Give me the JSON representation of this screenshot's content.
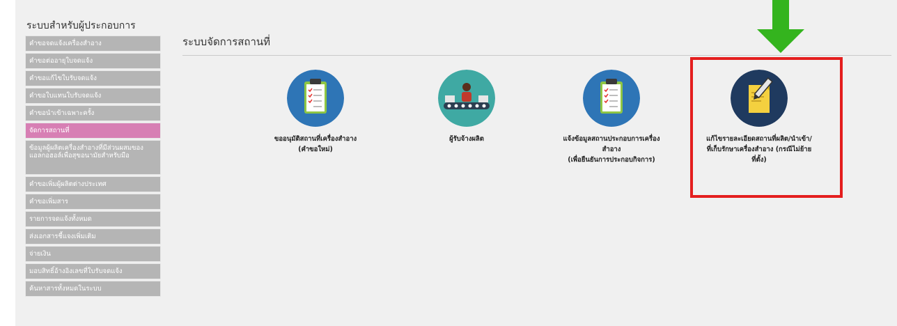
{
  "sidebar": {
    "title": "ระบบสำหรับผู้ประกอบการ",
    "items": [
      {
        "label": "คำขอจดแจ้งเครื่องสำอาง"
      },
      {
        "label": "คำขอต่ออายุใบจดแจ้ง"
      },
      {
        "label": "คำขอแก้ไขใบรับจดแจ้ง"
      },
      {
        "label": "คำขอใบแทนใบรับจดแจ้ง"
      },
      {
        "label": "คำขอนำเข้าเฉพาะครั้ง"
      },
      {
        "label": "จัดการสถานที่"
      },
      {
        "label": "ข้อมูลผู้ผลิตเครื่องสำอางที่มีส่วนผสมของแอลกอฮอล์เพื่อสุขอนามัยสำหรับมือ"
      },
      {
        "label": "คำขอเพิ่มผู้ผลิตต่างประเทศ"
      },
      {
        "label": "คำขอเพิ่มสาร"
      },
      {
        "label": "รายการจดแจ้งทั้งหมด"
      },
      {
        "label": "ส่งเอกสารชี้แจงเพิ่มเติม"
      },
      {
        "label": "จ่ายเงิน"
      },
      {
        "label": "มอบสิทธิ์อ้างอิงเลขที่ใบรับจดแจ้ง"
      },
      {
        "label": "ค้นหาสารทั้งหมดในระบบ"
      }
    ]
  },
  "main": {
    "title": "ระบบจัดการสถานที่",
    "tiles": [
      {
        "label": "ขออนุมัติสถานที่เครื่องสำอาง\n(คำขอใหม่)",
        "icon": "clipboard-icon"
      },
      {
        "label": "ผู้รับจ้างผลิต",
        "icon": "conveyor-worker-icon"
      },
      {
        "label": "แจ้งข้อมูลสถานประกอบการเครื่อง\nสำอาง\n(เพื่อยืนยันการประกอบกิจการ)",
        "icon": "clipboard-icon"
      },
      {
        "label": "แก้ไขรายละเอียดสถานที่ผลิต/นำเข้า/\nที่เก็บรักษาเครื่องสำอาง (กรณีไม่ย้าย\nที่ตั้ง)",
        "icon": "edit-note-icon"
      }
    ]
  },
  "colors": {
    "active_menu": "#d77fb4",
    "menu": "#b5b5b5",
    "icon_blue": "#2e75b6",
    "icon_teal": "#3fa9a3",
    "icon_navy": "#1f3a5f",
    "highlight": "#e41e1e",
    "arrow": "#34b41e"
  }
}
